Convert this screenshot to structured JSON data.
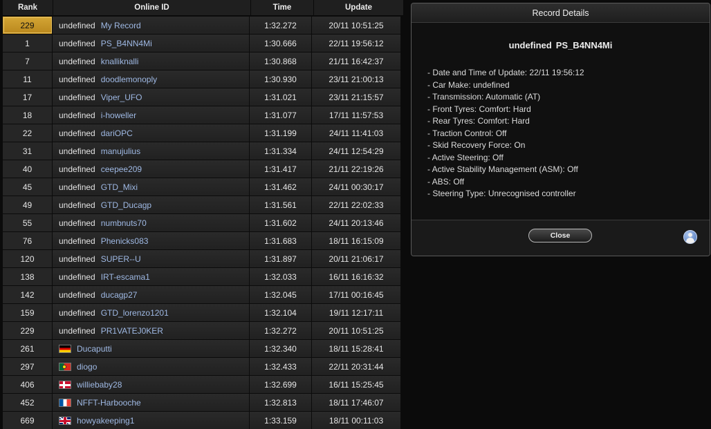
{
  "leaderboard": {
    "headers": {
      "rank": "Rank",
      "online_id": "Online ID",
      "time": "Time",
      "update": "Update"
    },
    "rows": [
      {
        "rank": "229",
        "country": "undefined",
        "name": "My Record",
        "time": "1:32.272",
        "update": "20/11 10:51:25",
        "flag": null,
        "highlight": true
      },
      {
        "rank": "1",
        "country": "undefined",
        "name": "PS_B4NN4Mi",
        "time": "1:30.666",
        "update": "22/11 19:56:12",
        "flag": null
      },
      {
        "rank": "7",
        "country": "undefined",
        "name": "knalliknalli",
        "time": "1:30.868",
        "update": "21/11 16:42:37",
        "flag": null
      },
      {
        "rank": "11",
        "country": "undefined",
        "name": "doodlemonoply",
        "time": "1:30.930",
        "update": "23/11 21:00:13",
        "flag": null
      },
      {
        "rank": "17",
        "country": "undefined",
        "name": "Viper_UFO",
        "time": "1:31.021",
        "update": "23/11 21:15:57",
        "flag": null
      },
      {
        "rank": "18",
        "country": "undefined",
        "name": "i-howeller",
        "time": "1:31.077",
        "update": "17/11 11:57:53",
        "flag": null
      },
      {
        "rank": "22",
        "country": "undefined",
        "name": "dariOPC",
        "time": "1:31.199",
        "update": "24/11 11:41:03",
        "flag": null
      },
      {
        "rank": "31",
        "country": "undefined",
        "name": "manujulius",
        "time": "1:31.334",
        "update": "24/11 12:54:29",
        "flag": null
      },
      {
        "rank": "40",
        "country": "undefined",
        "name": "ceepee209",
        "time": "1:31.417",
        "update": "21/11 22:19:26",
        "flag": null
      },
      {
        "rank": "45",
        "country": "undefined",
        "name": "GTD_Mixi",
        "time": "1:31.462",
        "update": "24/11 00:30:17",
        "flag": null
      },
      {
        "rank": "49",
        "country": "undefined",
        "name": "GTD_Ducagp",
        "time": "1:31.561",
        "update": "22/11 22:02:33",
        "flag": null
      },
      {
        "rank": "55",
        "country": "undefined",
        "name": "numbnuts70",
        "time": "1:31.602",
        "update": "24/11 20:13:46",
        "flag": null
      },
      {
        "rank": "76",
        "country": "undefined",
        "name": "Phenicks083",
        "time": "1:31.683",
        "update": "18/11 16:15:09",
        "flag": null
      },
      {
        "rank": "120",
        "country": "undefined",
        "name": "SUPER--U",
        "time": "1:31.897",
        "update": "20/11 21:06:17",
        "flag": null
      },
      {
        "rank": "138",
        "country": "undefined",
        "name": "IRT-escama1",
        "time": "1:32.033",
        "update": "16/11 16:16:32",
        "flag": null
      },
      {
        "rank": "142",
        "country": "undefined",
        "name": "ducagp27",
        "time": "1:32.045",
        "update": "17/11 00:16:45",
        "flag": null
      },
      {
        "rank": "159",
        "country": "undefined",
        "name": "GTD_lorenzo1201",
        "time": "1:32.104",
        "update": "19/11 12:17:11",
        "flag": null
      },
      {
        "rank": "229",
        "country": "undefined",
        "name": "PR1VATEJ0KER",
        "time": "1:32.272",
        "update": "20/11 10:51:25",
        "flag": null
      },
      {
        "rank": "261",
        "country": "",
        "name": "Ducaputti",
        "time": "1:32.340",
        "update": "18/11 15:28:41",
        "flag": "de"
      },
      {
        "rank": "297",
        "country": "",
        "name": "diogo",
        "time": "1:32.433",
        "update": "22/11 20:31:44",
        "flag": "pt"
      },
      {
        "rank": "406",
        "country": "",
        "name": "williebaby28",
        "time": "1:32.699",
        "update": "16/11 15:25:45",
        "flag": "dk"
      },
      {
        "rank": "452",
        "country": "",
        "name": "NFFT-Harbooche",
        "time": "1:32.813",
        "update": "18/11 17:46:07",
        "flag": "fr"
      },
      {
        "rank": "669",
        "country": "",
        "name": "howyakeeping1",
        "time": "1:33.159",
        "update": "18/11 00:11:03",
        "flag": "gb"
      }
    ]
  },
  "details": {
    "title": "Record Details",
    "player_country": "undefined",
    "player_name": "PS_B4NN4Mi",
    "items": [
      "- Date and Time of Update: 22/11 19:56:12",
      "- Car Make: undefined",
      "- Transmission: Automatic (AT)",
      "- Front Tyres: Comfort: Hard",
      "- Rear Tyres: Comfort: Hard",
      "- Traction Control: Off",
      "- Skid Recovery Force: On",
      "- Active Steering: Off",
      "- Active Stability Management (ASM): Off",
      "- ABS: Off",
      "- Steering Type: Unrecognised controller"
    ],
    "close_label": "Close",
    "avatar_icon": "user-avatar-icon"
  },
  "colors": {
    "background": "#0b0b0b",
    "highlight_rank": "#c9971f",
    "name_text": "#9fb9e4"
  }
}
